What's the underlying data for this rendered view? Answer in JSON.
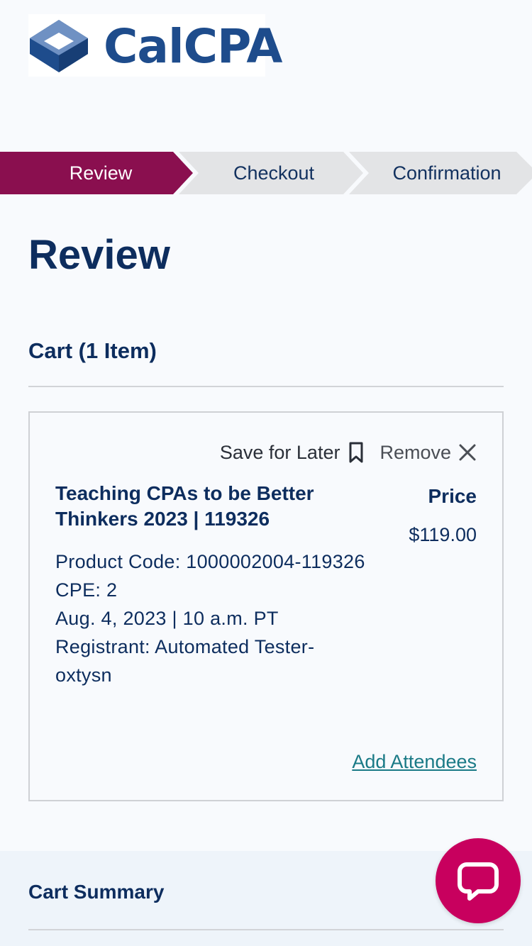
{
  "brand": {
    "logo_text": "CalCPA",
    "primary_color": "#1e4c8c",
    "accent_color": "#8a0f4f"
  },
  "steps": [
    {
      "label": "Review",
      "active": true
    },
    {
      "label": "Checkout",
      "active": false
    },
    {
      "label": "Confirmation",
      "active": false
    }
  ],
  "page": {
    "title": "Review"
  },
  "cart": {
    "heading": "Cart (1 Item)",
    "item": {
      "save_for_later": "Save for Later",
      "remove": "Remove",
      "title": "Teaching CPAs to be Better Thinkers 2023 | 119326",
      "product_code": "Product Code: 1000002004-119326",
      "cpe": "CPE: 2",
      "date": "Aug. 4, 2023 | 10 a.m. PT",
      "registrant": "Registrant: Automated Tester-oxtysn",
      "price_label": "Price",
      "price_value": "$119.00",
      "add_attendees": "Add Attendees"
    }
  },
  "summary": {
    "title": "Cart Summary"
  },
  "chat": {
    "icon": "chat-bubble-icon",
    "color": "#c8005e"
  }
}
